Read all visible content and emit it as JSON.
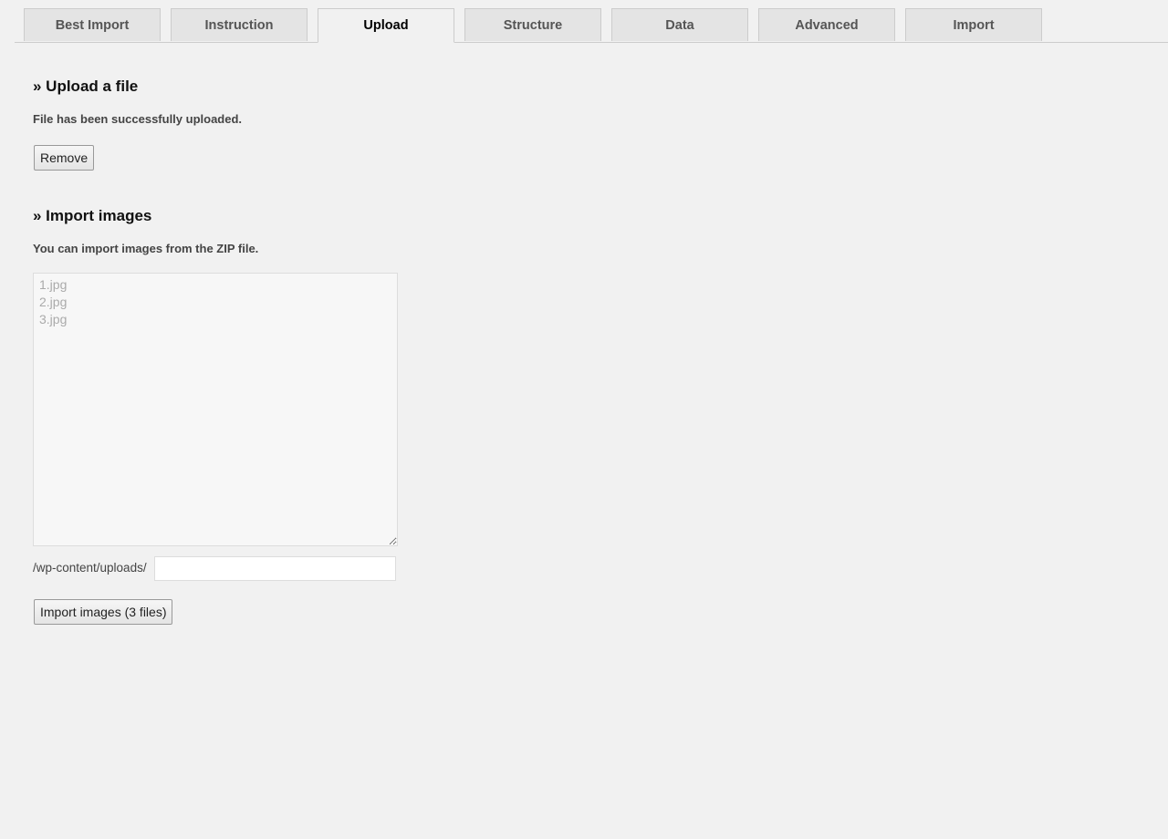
{
  "tabs": [
    {
      "label": "Best Import",
      "active": false
    },
    {
      "label": "Instruction",
      "active": false
    },
    {
      "label": "Upload",
      "active": true
    },
    {
      "label": "Structure",
      "active": false
    },
    {
      "label": "Data",
      "active": false
    },
    {
      "label": "Advanced",
      "active": false
    },
    {
      "label": "Import",
      "active": false
    }
  ],
  "upload": {
    "heading": "» Upload a file",
    "status": "File has been successfully uploaded.",
    "remove_label": "Remove"
  },
  "images": {
    "heading": "» Import images",
    "description": "You can import images from the ZIP file.",
    "file_list": "1.jpg\n2.jpg\n3.jpg",
    "path_prefix": "/wp-content/uploads/",
    "path_value": "",
    "import_label": "Import images (3 files)"
  }
}
